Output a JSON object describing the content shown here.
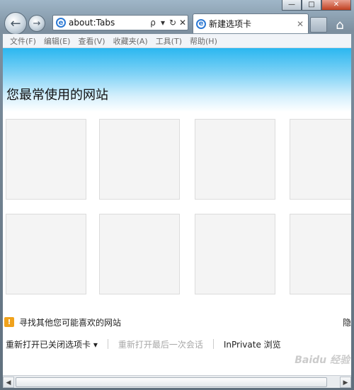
{
  "window": {
    "minimize": "—",
    "maximize": "□",
    "close": "✕"
  },
  "nav": {
    "address_url": "about:Tabs",
    "search_glyph": "ρ",
    "dropdown_glyph": "▾",
    "refresh_glyph": "↻",
    "stop_glyph": "✕",
    "back_glyph": "←",
    "forward_glyph": "→",
    "home_glyph": "⌂"
  },
  "tab": {
    "title": "新建选项卡",
    "close_glyph": "✕"
  },
  "menu": [
    "文件(F)",
    "编辑(E)",
    "查看(V)",
    "收藏夹(A)",
    "工具(T)",
    "帮助(H)"
  ],
  "content": {
    "heading": "您最常使用的网站",
    "find_more": "寻找其他您可能喜欢的网站",
    "hide_link": "隐",
    "reopen_tabs": "重新打开已关闭选项卡 ▾",
    "reopen_session": "重新打开最后一次会话",
    "inprivate": "InPrivate 浏览"
  },
  "scroll": {
    "left": "◀",
    "right": "▶"
  },
  "watermark": "Baidu 经验",
  "colors": {
    "banner_top": "#2bb7f0",
    "find_icon": "#f0a21c",
    "close_button": "#c04020"
  }
}
